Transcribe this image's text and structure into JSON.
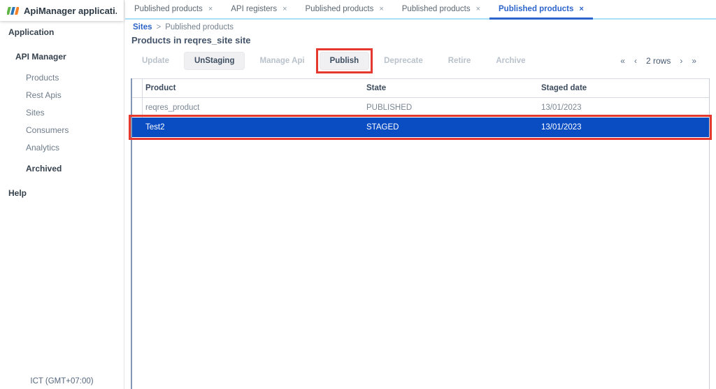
{
  "app": {
    "title": "ApiManager applicati...",
    "timezone": "ICT (GMT+07:00)"
  },
  "sidebar": {
    "items": [
      {
        "label": "Application"
      },
      {
        "label": "API Manager"
      },
      {
        "label": "Products"
      },
      {
        "label": "Rest Apis"
      },
      {
        "label": "Sites"
      },
      {
        "label": "Consumers"
      },
      {
        "label": "Analytics"
      },
      {
        "label": "Archived"
      },
      {
        "label": "Help"
      }
    ]
  },
  "tabs": {
    "close_glyph": "×",
    "items": [
      {
        "label": "Published products",
        "active": false
      },
      {
        "label": "API registers",
        "active": false
      },
      {
        "label": "Published products",
        "active": false
      },
      {
        "label": "Published products",
        "active": false
      },
      {
        "label": "Published products",
        "active": true
      }
    ]
  },
  "breadcrumb": {
    "parent": "Sites",
    "separator": ">",
    "current": "Published products"
  },
  "page": {
    "title": "Products in reqres_site site"
  },
  "toolbar": {
    "buttons": [
      {
        "label": "Update",
        "enabled": false
      },
      {
        "label": "UnStaging",
        "enabled": true
      },
      {
        "label": "Manage Api",
        "enabled": false
      },
      {
        "label": "Publish",
        "enabled": true,
        "annotated": true
      },
      {
        "label": "Deprecate",
        "enabled": false
      },
      {
        "label": "Retire",
        "enabled": false
      },
      {
        "label": "Archive",
        "enabled": false
      }
    ],
    "pagination": {
      "first": "«",
      "prev": "‹",
      "label": "2 rows",
      "next": "›",
      "last": "»"
    }
  },
  "table": {
    "columns": [
      "Product",
      "State",
      "Staged date"
    ],
    "rows": [
      {
        "product": "reqres_product",
        "state": "PUBLISHED",
        "staged_date": "13/01/2023",
        "selected": false
      },
      {
        "product": "Test2",
        "state": "STAGED",
        "staged_date": "13/01/2023",
        "selected": true
      }
    ]
  },
  "colors": {
    "accent_blue": "#2d65cc",
    "selected_row_blue": "#0a4dc3",
    "annotation_red": "#e5392f",
    "tabbar_line_blue": "#a9dff7",
    "disabled_text": "#b9c2cb",
    "logo_green": "#61b546",
    "logo_blue": "#2e75b6",
    "logo_orange": "#f58025"
  }
}
